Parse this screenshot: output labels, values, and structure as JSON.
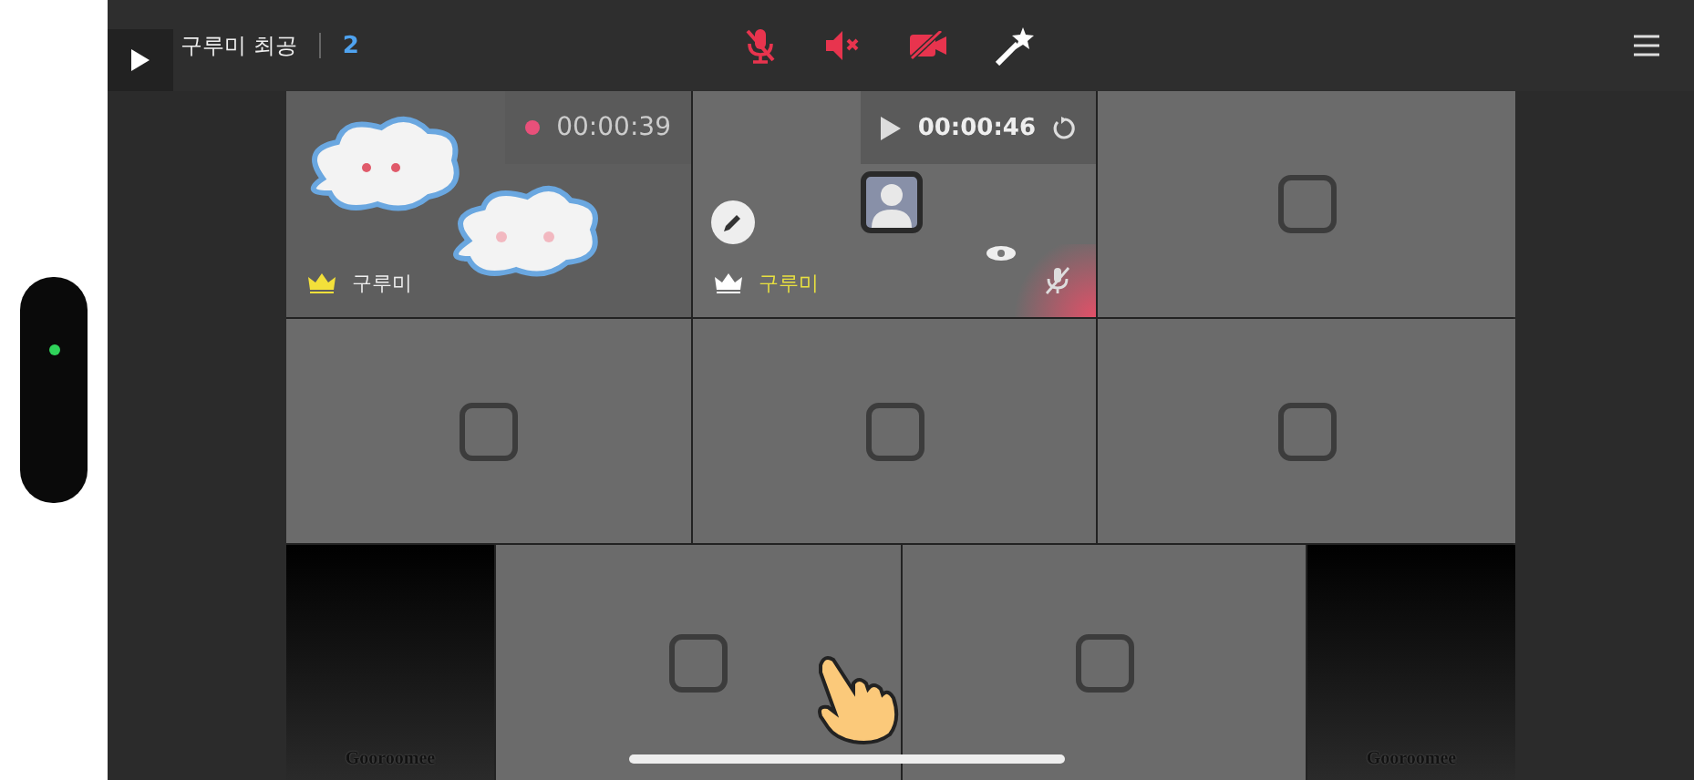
{
  "header": {
    "title": "구루미 최공",
    "participant_count": "2"
  },
  "toolbar": [
    {
      "kind": "mic",
      "on": false
    },
    {
      "kind": "speaker",
      "on": false
    },
    {
      "kind": "camera",
      "on": false
    },
    {
      "kind": "effects",
      "on": true
    }
  ],
  "tiles": [
    {
      "kind": "video",
      "timer": "00:00:39",
      "recording": true,
      "name": "구루미",
      "highlighted": false
    },
    {
      "kind": "participant",
      "timer": "00:00:46",
      "recording": false,
      "name": "구루미",
      "highlighted": true,
      "mic_muted": true
    },
    {
      "kind": "empty"
    },
    {
      "kind": "empty"
    },
    {
      "kind": "empty"
    },
    {
      "kind": "empty"
    }
  ],
  "bottom_tiles": [
    {
      "kind": "logo",
      "label": "Gooroomee"
    },
    {
      "kind": "empty"
    },
    {
      "kind": "empty"
    },
    {
      "kind": "logo",
      "label": "Gooroomee"
    }
  ]
}
